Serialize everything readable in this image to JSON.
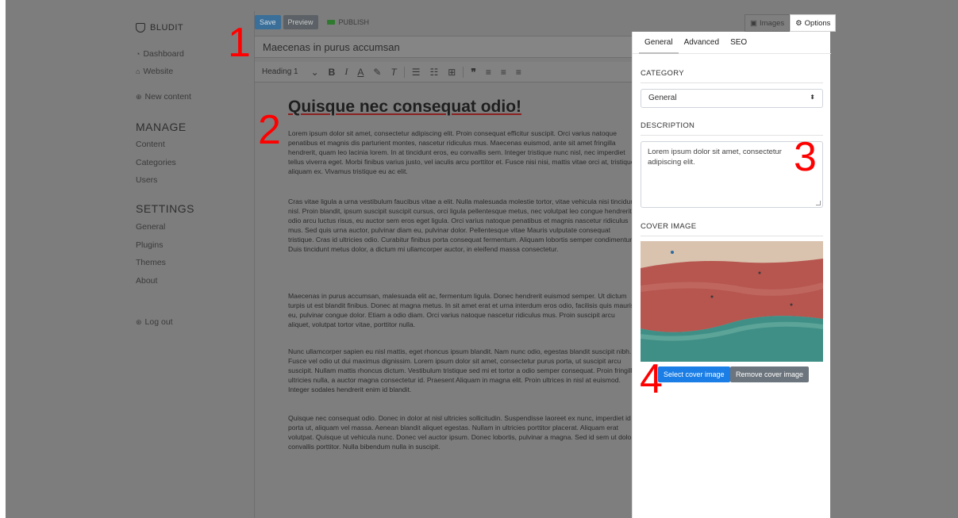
{
  "sidebar": {
    "brand": "BLUDIT",
    "links": {
      "dashboard": "Dashboard",
      "website": "Website",
      "new_content": "New content"
    },
    "manage_heading": "MANAGE",
    "manage_items": [
      "Content",
      "Categories",
      "Users"
    ],
    "settings_heading": "SETTINGS",
    "settings_items": [
      "General",
      "Plugins",
      "Themes",
      "About"
    ],
    "logout": "Log out"
  },
  "toolbar_top": {
    "save": "Save",
    "preview": "Preview",
    "publish": "PUBLISH",
    "images_tab": "Images",
    "options_tab": "Options"
  },
  "editor": {
    "title_value": "Maecenas in purus accumsan",
    "heading_select": "Heading 1",
    "content_heading": "Quisque nec consequat odio!",
    "paragraphs": [
      "Lorem ipsum dolor sit amet, consectetur adipiscing elit. Proin consequat efficitur suscipit. Orci varius natoque penatibus et magnis dis parturient montes, nascetur ridiculus mus. Maecenas euismod, ante sit amet fringilla hendrerit, quam leo lacinia lorem. In at tincidunt eros, eu convallis sem. Integer tristique nunc nisl, nec imperdiet tellus viverra eget. Morbi finibus varius justo, vel iaculis arcu porttitor et. Fusce nisi nisi, mattis vitae orci at, tristique aliquam ex. Vivamus tristique eu ac elit.",
      "Cras vitae ligula a urna vestibulum faucibus vitae a elit. Nulla malesuada molestie tortor, vitae vehicula nisi tincidunt nisl. Proin blandit, ipsum suscipit suscipit cursus, orci ligula pellentesque metus, nec volutpat leo congue hendrerit, odio arcu luctus risus, eu auctor sem eros eget ligula. Orci varius natoque penatibus et magnis nascetur ridiculus mus. Sed quis urna auctor, pulvinar diam eu, pulvinar dolor. Pellentesque vitae Mauris vulputate consequat tristique. Cras id ultricies odio. Curabitur finibus porta consequat fermentum. Aliquam lobortis semper condimentum. Duis tincidunt metus dolor, a dictum mi ullamcorper auctor, in eleifend massa consectetur.",
      "Maecenas in purus accumsan, malesuada elit ac, fermentum ligula. Donec hendrerit euismod semper. Ut dictum turpis ut est blandit finibus. Donec at magna metus. In sit amet erat et urna interdum eros odio, facilisis quis mauris eu, pulvinar congue dolor. Etiam a odio diam. Orci varius natoque nascetur ridiculus mus. Proin suscipit arcu aliquet, volutpat tortor vitae, porttitor nulla.",
      "Nunc ullamcorper sapien eu nisl mattis, eget rhoncus ipsum blandit. Nam nunc odio, egestas blandit suscipit nibh. Fusce vel odio ut dui maximus dignissim. Lorem ipsum dolor sit amet, consectetur purus porta, ut suscipit arcu suscipit. Nullam mattis rhoncus dictum. Vestibulum tristique sed mi et tortor a odio semper consequat. Proin fringilla ultricies nulla, a auctor magna consectetur id. Praesent Aliquam in magna elit. Proin ultrices in nisl at euismod. Integer sodales hendrerit enim id blandit.",
      "Quisque nec consequat odio. Donec in dolor at nisl ultricies sollicitudin. Suspendisse laoreet ex nunc, imperdiet id porta ut, aliquam vel massa. Aenean blandit aliquet egestas. Nullam in ultricies porttitor placerat. Aliquam erat volutpat. Quisque ut vehicula nunc. Donec vel auctor ipsum. Donec lobortis, pulvinar a magna. Sed id sem ut dolor convallis porttitor. Nulla bibendum nulla in suscipit."
    ]
  },
  "panel": {
    "tabs": [
      "General",
      "Advanced",
      "SEO"
    ],
    "category_label": "CATEGORY",
    "category_value": "General",
    "description_label": "DESCRIPTION",
    "description_value": "Lorem ipsum dolor sit amet, consectetur adipiscing elit.",
    "cover_label": "COVER IMAGE",
    "select_cover": "Select cover image",
    "remove_cover": "Remove cover image"
  },
  "annotations": [
    "1",
    "2",
    "3",
    "4"
  ],
  "colors": {
    "annotation": "#ff0000",
    "select_button": "#1a7ee6",
    "remove_button": "#6c757d",
    "backdrop": "#7d7d7d"
  }
}
